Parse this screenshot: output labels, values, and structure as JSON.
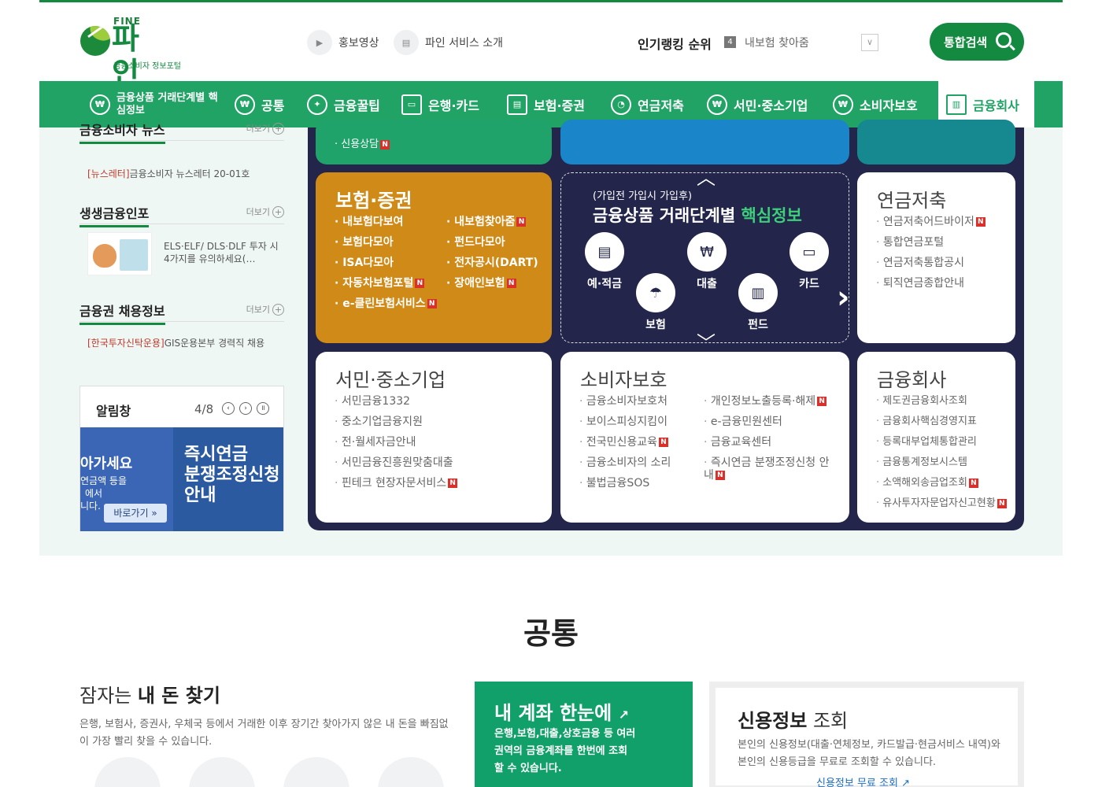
{
  "header": {
    "logo_top": "FINE",
    "logo_name": "파 인",
    "logo_sub": "금융소비자 정보포털",
    "links": [
      {
        "label": "홍보영상"
      },
      {
        "label": "파인 서비스 소개"
      }
    ],
    "ranking_title": "인기랭킹 순위",
    "ranking_no": "4",
    "ranking_text": "내보험 찾아줌",
    "search_label": "통합검색"
  },
  "gnb": {
    "items": [
      {
        "label": "금융상품 거래단계별 핵심정보"
      },
      {
        "label": "공통"
      },
      {
        "label": "금융꿀팁"
      },
      {
        "label": "은행·카드"
      },
      {
        "label": "보험·증권"
      },
      {
        "label": "연금저축"
      },
      {
        "label": "서민·중소기업"
      },
      {
        "label": "소비자보호"
      },
      {
        "label": "금융회사"
      }
    ]
  },
  "left": {
    "news_title": "금융소비자 뉴스",
    "news_more": "더보기",
    "news_tag": "[뉴스레터]",
    "news_text": "금융소비자 뉴스레터 20-01호",
    "info_title": "생생금융인포",
    "info_more": "더보기",
    "info_text": "ELS·ELF/ DLS·DLF 투자 시 4가지를 유의하세요(…",
    "job_title": "금융권 채용정보",
    "job_more": "더보기",
    "job_tag": "[한국투자신탁운용]",
    "job_text": "GIS운용본부 경력직 채용",
    "notice_title": "알림창",
    "notice_page": "4/8",
    "banner_l1": "아가세요",
    "banner_l2": "연금액 등을",
    "banner_l3": "에서",
    "banner_l4": "니다.",
    "banner_go": "바로가기",
    "banner_title": "즉시연금\n분쟁조정신청\n안내"
  },
  "cards": {
    "top1_text": "신용상담",
    "insurance": {
      "title": "보험·증권",
      "col1": [
        "내보험다보여",
        "보험다모아",
        "ISA다모아",
        "자동차보험포털",
        "e-클린보험서비스"
      ],
      "col2": [
        "내보험찾아줌",
        "펀드다모아",
        "전자공시(DART)",
        "장애인보험"
      ]
    },
    "center": {
      "sub": "(가입전 가입시 가입후)",
      "title": "금융상품 거래단계별 ",
      "title_hl": "핵심정보",
      "items": [
        "예·적금",
        "대출",
        "카드",
        "보험",
        "펀드"
      ]
    },
    "pension": {
      "title": "연금저축",
      "items": [
        "연금저축어드바이저",
        "통합연금포털",
        "연금저축통합공시",
        "퇴직연금종합안내"
      ]
    },
    "smb": {
      "title": "서민·중소기업",
      "items": [
        "서민금융1332",
        "중소기업금융지원",
        "전·월세자금안내",
        "서민금융진흥원맞춤대출",
        "핀테크 현장자문서비스"
      ]
    },
    "consumer": {
      "title": "소비자보호",
      "col1": [
        "금융소비자보호처",
        "보이스피싱지킴이",
        "전국민신용교육",
        "금융소비자의 소리",
        "불법금융SOS"
      ],
      "col2": [
        "개인정보노출등록·해제",
        "e-금융민원센터",
        "금융교육센터",
        "즉시연금 분쟁조정신청 안내"
      ]
    },
    "fincomp": {
      "title": "금융회사",
      "items": [
        "제도권금융회사조회",
        "금융회사핵심경영지표",
        "등록대부업체통합관리",
        "금융통계정보시스템",
        "소액해외송금업조회",
        "유사투자자문업자신고현황"
      ]
    }
  },
  "section2": {
    "title": "공통",
    "find_title_a": "잠자는 ",
    "find_title_b": "내 돈 찾기",
    "find_desc": "은행, 보험사, 증권사, 우체국 등에서 거래한 이후 장기간 찾아가지 않은 내 돈을 빠짐없이 가장 빨리 찾을 수 있습니다.",
    "acct_title": "내 계좌 한눈에",
    "acct_desc": "은행,보험,대출,상호금융 등 여러 권역의 금융계좌를 한번에 조회 할 수 있습니다.",
    "credit_title_a": "신용정보",
    "credit_title_b": " 조회",
    "credit_desc": "본인의 신용정보(대출·연체정보, 카드발급·현금서비스 내역)와 본인의 신용등급을 무료로 조회할 수 있습니다.",
    "credit_link": "신용정보 무료 조회"
  },
  "colors": {
    "brand": "#138a3f",
    "gnb": "#21a365",
    "panel": "#23254b",
    "insurance": "#cf8a17",
    "new_badge": "#d9302c"
  }
}
